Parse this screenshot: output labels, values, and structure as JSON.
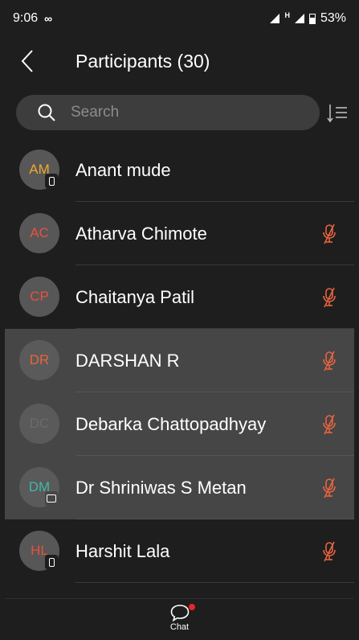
{
  "status_bar": {
    "time": "9:06",
    "network": "H",
    "battery": "53%"
  },
  "header": {
    "title": "Participants (30)"
  },
  "search": {
    "placeholder": "Search"
  },
  "participants": [
    {
      "initials": "AM",
      "initials_color": "#f0a830",
      "name": "Anant mude",
      "device": "phone",
      "muted": false,
      "highlighted": false
    },
    {
      "initials": "AC",
      "initials_color": "#e8523f",
      "name": "Atharva Chimote",
      "device": "",
      "muted": true,
      "highlighted": false
    },
    {
      "initials": "CP",
      "initials_color": "#e8523f",
      "name": "Chaitanya Patil",
      "device": "",
      "muted": true,
      "highlighted": false
    },
    {
      "initials": "DR",
      "initials_color": "#e8643f",
      "name": "DARSHAN R",
      "device": "",
      "muted": true,
      "highlighted": true
    },
    {
      "initials": "DC",
      "initials_color": "#6a6a6a",
      "name": "Debarka Chattopadhyay",
      "device": "",
      "muted": true,
      "highlighted": true
    },
    {
      "initials": "DM",
      "initials_color": "#3fb8a8",
      "name": "Dr Shriniwas S Metan",
      "device": "tablet",
      "muted": true,
      "highlighted": true
    },
    {
      "initials": "HL",
      "initials_color": "#e8523f",
      "name": "Harshit Lala",
      "device": "phone",
      "muted": true,
      "highlighted": false
    }
  ],
  "bottom_bar": {
    "chat_label": "Chat"
  },
  "colors": {
    "background": "#1e1e1e",
    "highlight_row": "#464646",
    "muted_icon": "#e8643f",
    "notification_dot": "#e8242a"
  }
}
